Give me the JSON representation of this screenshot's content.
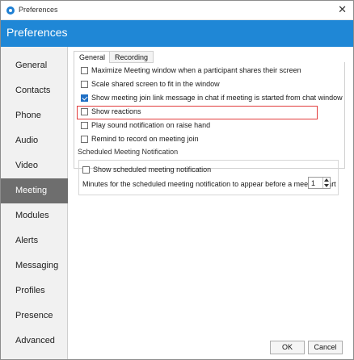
{
  "window": {
    "title": "Preferences"
  },
  "header": {
    "title": "Preferences"
  },
  "sidebar": {
    "items": [
      {
        "label": "General",
        "active": false
      },
      {
        "label": "Contacts",
        "active": false
      },
      {
        "label": "Phone",
        "active": false
      },
      {
        "label": "Audio",
        "active": false
      },
      {
        "label": "Video",
        "active": false
      },
      {
        "label": "Meeting",
        "active": true
      },
      {
        "label": "Modules",
        "active": false
      },
      {
        "label": "Alerts",
        "active": false
      },
      {
        "label": "Messaging",
        "active": false
      },
      {
        "label": "Profiles",
        "active": false
      },
      {
        "label": "Presence",
        "active": false
      },
      {
        "label": "Advanced",
        "active": false
      }
    ]
  },
  "tabs": [
    {
      "label": "General",
      "active": true
    },
    {
      "label": "Recording",
      "active": false
    }
  ],
  "general": {
    "options": [
      {
        "label": "Maximize Meeting window when a participant shares their screen",
        "checked": false
      },
      {
        "label": "Scale shared screen to fit in the window",
        "checked": false
      },
      {
        "label": "Show meeting join link message in chat if meeting is started from chat window",
        "checked": true
      },
      {
        "label": "Show reactions",
        "checked": false
      },
      {
        "label": "Play sound notification on raise hand",
        "checked": false
      },
      {
        "label": "Remind to record on meeting join",
        "checked": false
      }
    ]
  },
  "scheduled": {
    "title": "Scheduled Meeting Notification",
    "show_label": "Show scheduled meeting notification",
    "show_checked": false,
    "minutes_label": "Minutes for the scheduled meeting notification to appear before a meeting start",
    "minutes_value": "1"
  },
  "footer": {
    "ok_label": "OK",
    "cancel_label": "Cancel"
  },
  "colors": {
    "header": "#1f87d6",
    "active_sidebar": "#6e6e6e",
    "highlight": "#e23c3c",
    "checkbox_checked": "#1f6fc4"
  },
  "icons": {
    "app": "app-logo-icon",
    "close": "close-icon"
  }
}
